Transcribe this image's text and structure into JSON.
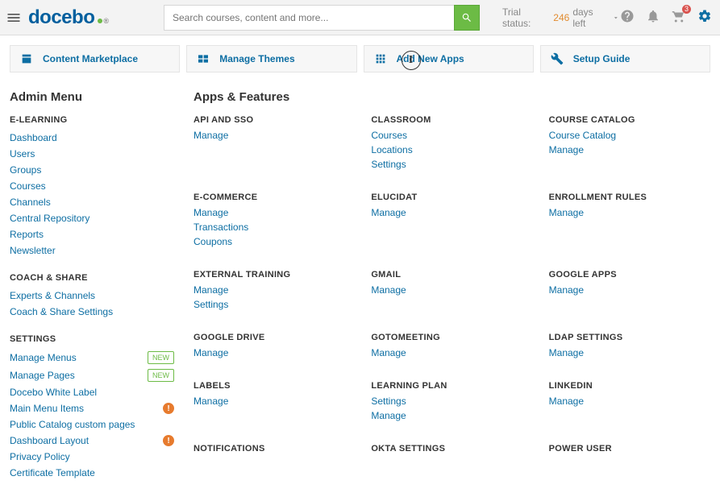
{
  "header": {
    "logo_text": "docebo",
    "search_placeholder": "Search courses, content and more...",
    "trial_prefix": "Trial status:",
    "trial_days": "246",
    "trial_suffix": "days left",
    "cart_badge": "3"
  },
  "cards": [
    {
      "label": "Content Marketplace",
      "icon": "marketplace-icon"
    },
    {
      "label": "Manage Themes",
      "icon": "themes-icon"
    },
    {
      "label": "Add New Apps",
      "icon": "apps-icon"
    },
    {
      "label": "Setup Guide",
      "icon": "wrench-icon"
    }
  ],
  "sidebar_title": "Admin Menu",
  "content_title": "Apps & Features",
  "sidebar": {
    "groups": [
      {
        "heading": "E-LEARNING",
        "items": [
          {
            "label": "Dashboard"
          },
          {
            "label": "Users"
          },
          {
            "label": "Groups"
          },
          {
            "label": "Courses"
          },
          {
            "label": "Channels"
          },
          {
            "label": "Central Repository"
          },
          {
            "label": "Reports"
          },
          {
            "label": "Newsletter"
          }
        ]
      },
      {
        "heading": "COACH & SHARE",
        "items": [
          {
            "label": "Experts & Channels"
          },
          {
            "label": "Coach & Share Settings"
          }
        ]
      },
      {
        "heading": "SETTINGS",
        "items": [
          {
            "label": "Manage Menus",
            "tag": "NEW"
          },
          {
            "label": "Manage Pages",
            "tag": "NEW"
          },
          {
            "label": "Docebo White Label"
          },
          {
            "label": "Main Menu Items",
            "warn": true
          },
          {
            "label": "Public Catalog custom pages"
          },
          {
            "label": "Dashboard Layout",
            "warn": true
          },
          {
            "label": "Privacy Policy"
          },
          {
            "label": "Certificate Template"
          }
        ]
      }
    ]
  },
  "features": [
    {
      "title": "API AND SSO",
      "links": [
        "Manage"
      ]
    },
    {
      "title": "CLASSROOM",
      "links": [
        "Courses",
        "Locations",
        "Settings"
      ]
    },
    {
      "title": "COURSE CATALOG",
      "links": [
        "Course Catalog",
        "Manage"
      ]
    },
    {
      "title": "E-COMMERCE",
      "links": [
        "Manage",
        "Transactions",
        "Coupons"
      ]
    },
    {
      "title": "ELUCIDAT",
      "links": [
        "Manage"
      ]
    },
    {
      "title": "ENROLLMENT RULES",
      "links": [
        "Manage"
      ]
    },
    {
      "title": "EXTERNAL TRAINING",
      "links": [
        "Manage",
        "Settings"
      ]
    },
    {
      "title": "GMAIL",
      "links": [
        "Manage"
      ]
    },
    {
      "title": "GOOGLE APPS",
      "links": [
        "Manage"
      ]
    },
    {
      "title": "GOOGLE DRIVE",
      "links": [
        "Manage"
      ]
    },
    {
      "title": "GOTOMEETING",
      "links": [
        "Manage"
      ]
    },
    {
      "title": "LDAP SETTINGS",
      "links": [
        "Manage"
      ]
    },
    {
      "title": "LABELS",
      "links": [
        "Manage"
      ]
    },
    {
      "title": "LEARNING PLAN",
      "links": [
        "Settings",
        "Manage"
      ]
    },
    {
      "title": "LINKEDIN",
      "links": [
        "Manage"
      ]
    },
    {
      "title": "NOTIFICATIONS",
      "links": []
    },
    {
      "title": "OKTA SETTINGS",
      "links": []
    },
    {
      "title": "POWER USER",
      "links": []
    }
  ]
}
